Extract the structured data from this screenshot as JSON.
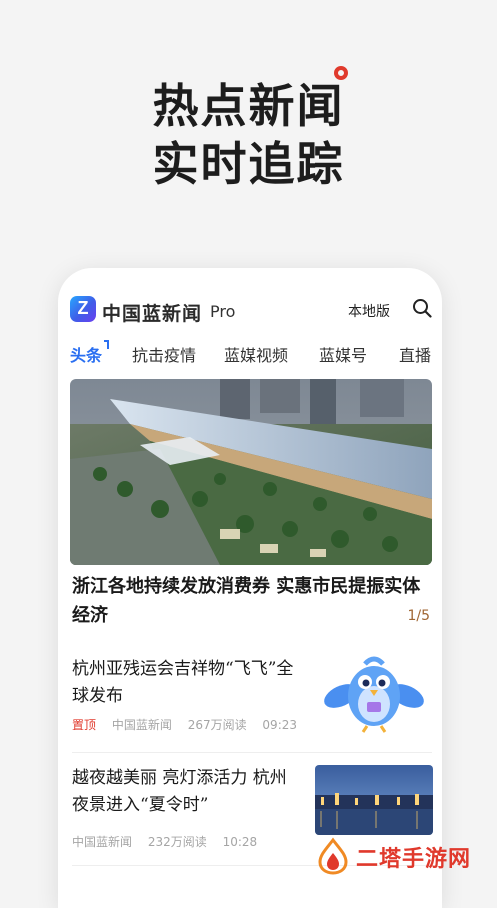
{
  "banner": {
    "line1": "热点新闻",
    "line2": "实时追踪",
    "accent": "#e03a2c"
  },
  "app": {
    "name": "中国蓝新闻",
    "pro": "Pro",
    "local_label": "本地版",
    "search_icon": "search-icon",
    "brand_color": "#2a6ff1"
  },
  "tabs": [
    {
      "label": "头条",
      "active": true
    },
    {
      "label": "抗击疫情"
    },
    {
      "label": "蓝媒视频"
    },
    {
      "label": "蓝媒号"
    },
    {
      "label": "直播"
    }
  ],
  "hero": {
    "title": "浙江各地持续发放消费券 实惠市民提振实体经济",
    "page": "1/5"
  },
  "news": [
    {
      "title": "杭州亚残运会吉祥物“飞飞”全球发布",
      "tag": "置顶",
      "source": "中国蓝新闻",
      "reads": "267万阅读",
      "time": "09:23"
    },
    {
      "title": "越夜越美丽 亮灯添活力 杭州夜景进入“夏令时”",
      "source": "中国蓝新闻",
      "reads": "232万阅读",
      "time": "10:28"
    }
  ],
  "watermark": {
    "text": "二塔手游网"
  }
}
